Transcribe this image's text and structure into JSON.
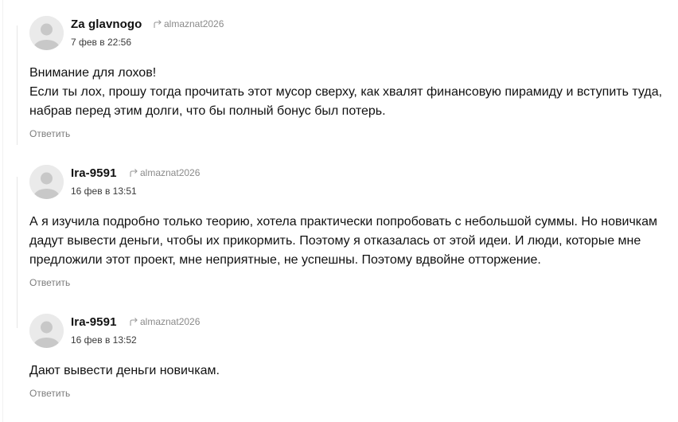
{
  "comments": [
    {
      "author": "Za glavnogo",
      "reply_to": "almaznat2026",
      "date": "7 фев в 22:56",
      "text": "Внимание для лохов!\nЕсли ты лох, прошу тогда прочитать этот мусор сверху, как хвалят финансовую пирамиду и вступить туда, набрав перед этим долги, что бы полный бонус был потерь.",
      "reply_label": "Ответить"
    },
    {
      "author": "Ira-9591",
      "reply_to": "almaznat2026",
      "date": "16 фев в 13:51",
      "text": "А я изучила подробно только теорию, хотела практически попробовать с небольшой суммы. Но новичкам дадут вывести деньги, чтобы их прикормить. Поэтому я отказалась от этой идеи. И люди, которые мне предложили этот проект, мне неприятные, не успешны. Поэтому вдвойне отторжение.",
      "reply_label": "Ответить"
    },
    {
      "author": "Ira-9591",
      "reply_to": "almaznat2026",
      "date": "16 фев в 13:52",
      "text": "Дают вывести деньги новичкам.",
      "reply_label": "Ответить"
    }
  ],
  "colors": {
    "avatar_bg": "#eaeaea",
    "avatar_fg": "#c8c8c8",
    "muted_text": "#7d7d7d",
    "thread_line": "#e6e6e6"
  },
  "icons": {
    "reply_to": "reply-arrow-icon",
    "avatar": "user-avatar-icon"
  }
}
